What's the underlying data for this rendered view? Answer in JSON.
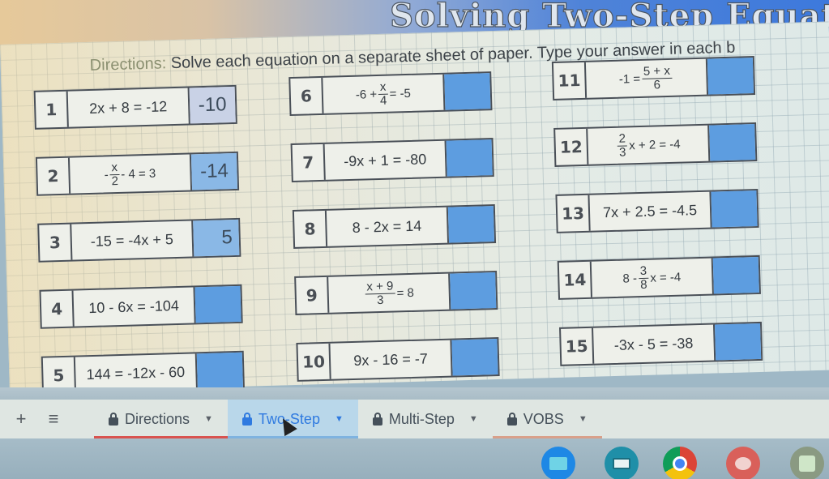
{
  "header": {
    "title": "Solving Two-Step Equat"
  },
  "directions": {
    "label": "Directions:",
    "text": "Solve each equation on a separate sheet of paper.  Type your answer in each b"
  },
  "problems": [
    {
      "num": "1",
      "equation": "2x + 8 = -12",
      "answer": "-10"
    },
    {
      "num": "2",
      "equation_parts": {
        "pre": "- ",
        "num": "x",
        "den": "2",
        "post": " - 4 = 3"
      },
      "answer": "-14"
    },
    {
      "num": "3",
      "equation": "-15 = -4x + 5",
      "answer": "5"
    },
    {
      "num": "4",
      "equation": "10 - 6x = -104",
      "answer": ""
    },
    {
      "num": "5",
      "equation": "144 = -12x - 60",
      "answer": ""
    },
    {
      "num": "6",
      "equation_parts": {
        "pre": "-6 + ",
        "num": "x",
        "den": "4",
        "post": " = -5"
      },
      "answer": ""
    },
    {
      "num": "7",
      "equation": "-9x + 1 = -80",
      "answer": ""
    },
    {
      "num": "8",
      "equation": "8 - 2x = 14",
      "answer": ""
    },
    {
      "num": "9",
      "equation_parts": {
        "pre": "",
        "num": "x + 9",
        "den": "3",
        "post": " = 8"
      },
      "answer": ""
    },
    {
      "num": "10",
      "equation": "9x - 16 = -7",
      "answer": ""
    },
    {
      "num": "11",
      "equation_parts": {
        "pre": "-1 = ",
        "num": "5 + x",
        "den": "6",
        "post": ""
      },
      "answer": ""
    },
    {
      "num": "12",
      "equation_parts": {
        "pre": "",
        "num": "2",
        "den": "3",
        "post": "x + 2 = -4"
      },
      "answer": ""
    },
    {
      "num": "13",
      "equation": "7x + 2.5 = -4.5",
      "answer": ""
    },
    {
      "num": "14",
      "equation_parts": {
        "pre": "8 - ",
        "num": "3",
        "den": "8",
        "post": "x = -4"
      },
      "answer": ""
    },
    {
      "num": "15",
      "equation": "-3x - 5 = -38",
      "answer": ""
    }
  ],
  "tabbar": {
    "add_icon": "+",
    "menu_icon": "≡",
    "tabs": [
      {
        "label": "Directions",
        "locked": true,
        "active": false,
        "underline": "#d9534f"
      },
      {
        "label": "Two-Step",
        "locked": true,
        "active": true,
        "underline": "#7fb3e0"
      },
      {
        "label": "Multi-Step",
        "locked": true,
        "active": false,
        "underline": ""
      },
      {
        "label": "VOBS",
        "locked": true,
        "active": false,
        "underline": "#d9a08a"
      }
    ]
  },
  "shelf": {
    "apps": [
      "files-icon",
      "classroom-icon",
      "chrome-icon",
      "paint-icon",
      "calculator-icon"
    ]
  },
  "colors": {
    "accent": "#2f7ae0",
    "answer_box": "#5d9de0"
  }
}
